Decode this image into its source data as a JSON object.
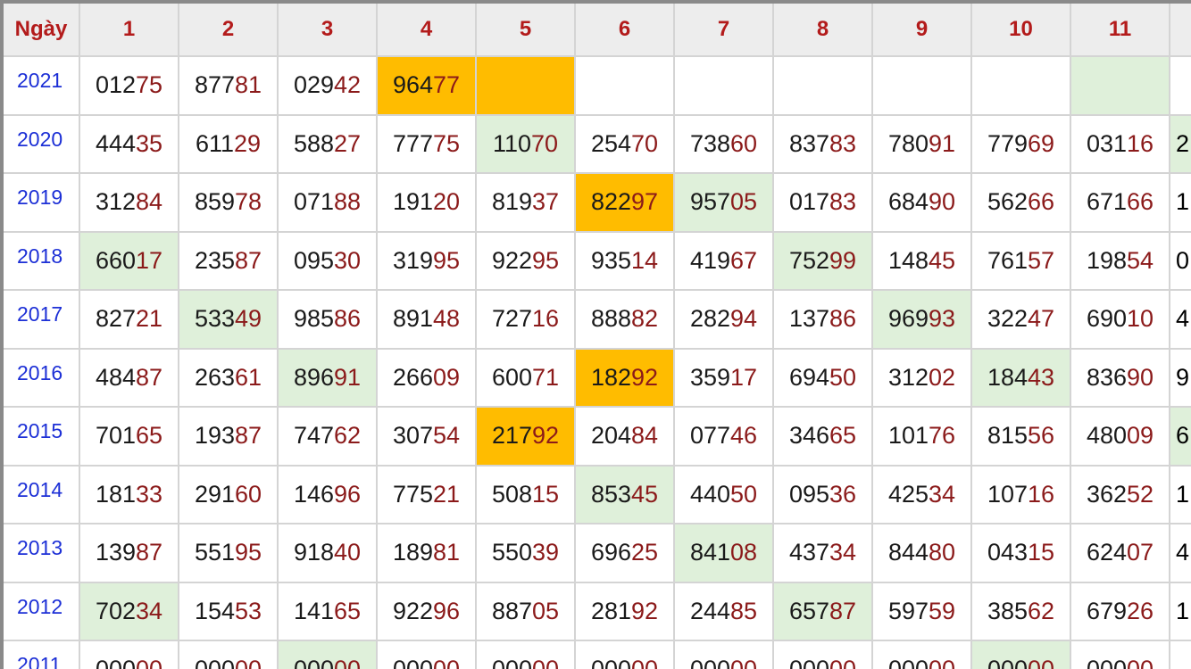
{
  "header": {
    "corner_label": "Ngày",
    "day_labels": [
      "1",
      "2",
      "3",
      "4",
      "5",
      "6",
      "7",
      "8",
      "9",
      "10",
      "11",
      ""
    ]
  },
  "colors": {
    "header_text": "#b31b1b",
    "year_text": "#1c2fd6",
    "number_tail": "#8b1a1a",
    "highlight_green": "#dff0da",
    "highlight_orange": "#ffbc00"
  },
  "rows": [
    {
      "year": "2021",
      "cells": [
        {
          "v": "01275"
        },
        {
          "v": "87781"
        },
        {
          "v": "02942"
        },
        {
          "v": "96477",
          "hl": "orange"
        },
        {
          "v": "",
          "hl": "orange"
        },
        {
          "v": ""
        },
        {
          "v": ""
        },
        {
          "v": ""
        },
        {
          "v": ""
        },
        {
          "v": ""
        },
        {
          "v": "",
          "hl": "green"
        },
        {
          "v": ""
        }
      ]
    },
    {
      "year": "2020",
      "cells": [
        {
          "v": "44435"
        },
        {
          "v": "61129"
        },
        {
          "v": "58827"
        },
        {
          "v": "77775"
        },
        {
          "v": "11070",
          "hl": "green"
        },
        {
          "v": "25470"
        },
        {
          "v": "73860"
        },
        {
          "v": "83783"
        },
        {
          "v": "78091"
        },
        {
          "v": "77969"
        },
        {
          "v": "03116"
        },
        {
          "v": "2",
          "hl": "green"
        }
      ]
    },
    {
      "year": "2019",
      "cells": [
        {
          "v": "31284"
        },
        {
          "v": "85978"
        },
        {
          "v": "07188"
        },
        {
          "v": "19120"
        },
        {
          "v": "81937"
        },
        {
          "v": "82297",
          "hl": "orange"
        },
        {
          "v": "95705",
          "hl": "green"
        },
        {
          "v": "01783"
        },
        {
          "v": "68490"
        },
        {
          "v": "56266"
        },
        {
          "v": "67166"
        },
        {
          "v": "1"
        }
      ]
    },
    {
      "year": "2018",
      "cells": [
        {
          "v": "66017",
          "hl": "green"
        },
        {
          "v": "23587"
        },
        {
          "v": "09530"
        },
        {
          "v": "31995"
        },
        {
          "v": "92295"
        },
        {
          "v": "93514"
        },
        {
          "v": "41967"
        },
        {
          "v": "75299",
          "hl": "green"
        },
        {
          "v": "14845"
        },
        {
          "v": "76157"
        },
        {
          "v": "19854"
        },
        {
          "v": "0"
        }
      ]
    },
    {
      "year": "2017",
      "cells": [
        {
          "v": "82721"
        },
        {
          "v": "53349",
          "hl": "green"
        },
        {
          "v": "98586"
        },
        {
          "v": "89148"
        },
        {
          "v": "72716"
        },
        {
          "v": "88882"
        },
        {
          "v": "28294"
        },
        {
          "v": "13786"
        },
        {
          "v": "96993",
          "hl": "green"
        },
        {
          "v": "32247"
        },
        {
          "v": "69010"
        },
        {
          "v": "4"
        }
      ]
    },
    {
      "year": "2016",
      "cells": [
        {
          "v": "48487"
        },
        {
          "v": "26361"
        },
        {
          "v": "89691",
          "hl": "green"
        },
        {
          "v": "26609"
        },
        {
          "v": "60071"
        },
        {
          "v": "18292",
          "hl": "orange"
        },
        {
          "v": "35917"
        },
        {
          "v": "69450"
        },
        {
          "v": "31202"
        },
        {
          "v": "18443",
          "hl": "green"
        },
        {
          "v": "83690"
        },
        {
          "v": "9"
        }
      ]
    },
    {
      "year": "2015",
      "cells": [
        {
          "v": "70165"
        },
        {
          "v": "19387"
        },
        {
          "v": "74762"
        },
        {
          "v": "30754"
        },
        {
          "v": "21792",
          "hl": "orange"
        },
        {
          "v": "20484"
        },
        {
          "v": "07746"
        },
        {
          "v": "34665"
        },
        {
          "v": "10176"
        },
        {
          "v": "81556"
        },
        {
          "v": "48009"
        },
        {
          "v": "6",
          "hl": "green"
        }
      ]
    },
    {
      "year": "2014",
      "cells": [
        {
          "v": "18133"
        },
        {
          "v": "29160"
        },
        {
          "v": "14696"
        },
        {
          "v": "77521"
        },
        {
          "v": "50815"
        },
        {
          "v": "85345",
          "hl": "green"
        },
        {
          "v": "44050"
        },
        {
          "v": "09536"
        },
        {
          "v": "42534"
        },
        {
          "v": "10716"
        },
        {
          "v": "36252"
        },
        {
          "v": "1"
        }
      ]
    },
    {
      "year": "2013",
      "cells": [
        {
          "v": "13987"
        },
        {
          "v": "55195"
        },
        {
          "v": "91840"
        },
        {
          "v": "18981"
        },
        {
          "v": "55039"
        },
        {
          "v": "69625"
        },
        {
          "v": "84108",
          "hl": "green"
        },
        {
          "v": "43734"
        },
        {
          "v": "84480"
        },
        {
          "v": "04315"
        },
        {
          "v": "62407"
        },
        {
          "v": "4"
        }
      ]
    },
    {
      "year": "2012",
      "cells": [
        {
          "v": "70234",
          "hl": "green"
        },
        {
          "v": "15453"
        },
        {
          "v": "14165"
        },
        {
          "v": "92296"
        },
        {
          "v": "88705"
        },
        {
          "v": "28192"
        },
        {
          "v": "24485"
        },
        {
          "v": "65787",
          "hl": "green"
        },
        {
          "v": "59759"
        },
        {
          "v": "38562"
        },
        {
          "v": "67926"
        },
        {
          "v": "1"
        }
      ]
    },
    {
      "year": "2011",
      "cells": [
        {
          "v": "00000"
        },
        {
          "v": "00000"
        },
        {
          "v": "00000",
          "hl": "green"
        },
        {
          "v": "00000"
        },
        {
          "v": "00000"
        },
        {
          "v": "00000"
        },
        {
          "v": "00000"
        },
        {
          "v": "00000"
        },
        {
          "v": "00000"
        },
        {
          "v": "00000",
          "hl": "green"
        },
        {
          "v": "00000"
        },
        {
          "v": ""
        }
      ]
    }
  ]
}
